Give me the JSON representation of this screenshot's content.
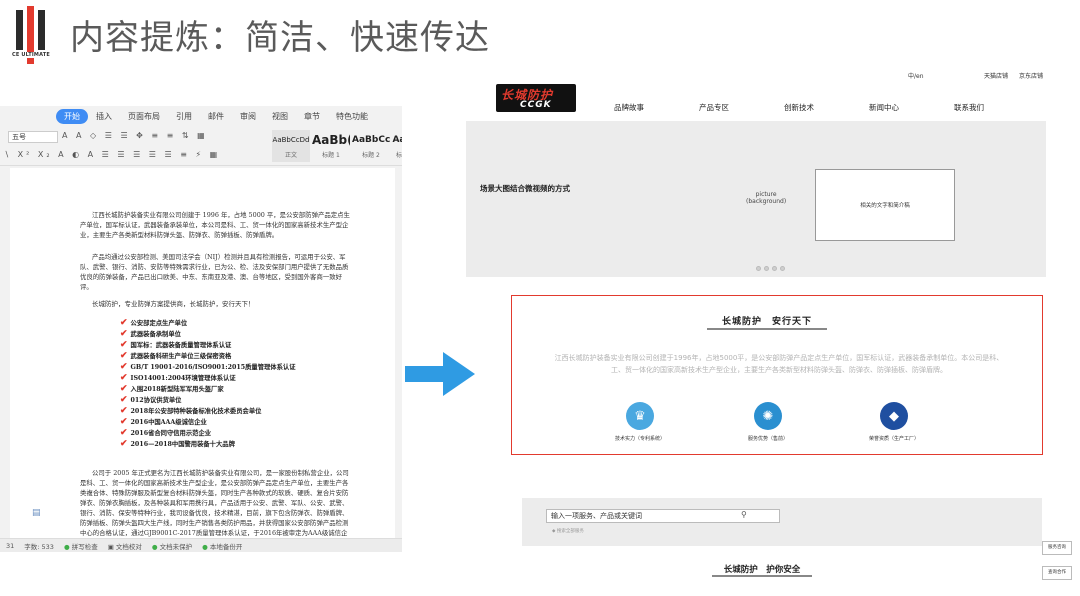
{
  "header": {
    "logo_text": "CE ULTIMATE",
    "title": "内容提炼：简洁、快速传达"
  },
  "word": {
    "tabs": [
      "开始",
      "插入",
      "页面布局",
      "引用",
      "邮件",
      "审阅",
      "视图",
      "章节",
      "特色功能"
    ],
    "font_size": "五号",
    "styles": [
      {
        "sample": "AaBbCcDd",
        "caption": "正文"
      },
      {
        "sample": "AaBb(",
        "caption": "标题 1"
      },
      {
        "sample": "AaBbCc",
        "caption": "标题 2"
      },
      {
        "sample": "Aa",
        "caption": "标"
      }
    ],
    "para1": "江西长城防护装备实业有限公司创建于 1996 年，占地 5000 平，是公安部防弹产品定点生产单位，国军标认证，武器装备承装单位，本公司是科、工、贸一体化的国家高新技术生产型企业，主要生产各类新型材料防弹头盔、防弹衣、防弹插板、防弹盾牌。",
    "para2": "产品均通过公安部检测、美国司法学会（NIJ）检测并且具有检测报告，可运用于公安、军队、武警、银行、消防、安防等特殊需求行业，已为公、检、法及安保部门用户提供了无数品质优良的防弹装备，产品已出口欧美、中东、东南亚及港、澳、台等地区，受到国外客商一致好评。",
    "slogan": "长城防护，专业防弹方案提供商，长城防护，安行天下！",
    "certs": [
      "公安部定点生产单位",
      "武器装备承制单位",
      "国军标：武器装备质量管理体系认证",
      "武器装备科研生产单位三级保密资格",
      "GB/T 19001-2016/ISO9001:2015质量管理体系认证",
      "ISO14001:2004环境管理体系认证",
      "入围2018新型陆军军用头盔厂家",
      "012协议供货单位",
      "2018年公安部特种装备标准化技术委员会单位",
      "2016中国AAA级诚信企业",
      "2016省合同守信用示范企业",
      "2016—2018中国警用装备十大品牌"
    ],
    "para3": "公司于 2005 年正式更名为江西长城防护装备实业有限公司，是一家股份制私营企业，公司是科、工、贸一体化的国家高新技术生产型企业，是公安部防弹产品定点生产单位，主要生产各类複合体、特殊防弹服及新型复合材料防弹头盔，同时生产各种款式的软质、硬质、复合片安防弹衣、防弹衣胸插板，及各种装具和军用携行具，产品适用于公安、武警、军队、公安、武警、银行、消防、保安等特种行业，我司设备优良，技术精湛，目前，旗下包含防弹衣、防弹盾牌、防弹插板、防弹头盔四大生产线，同时生产销售各类防护用品，并获得国家公安部防弹产品检测中心的合格认证，通过GJB9001C-2017质量管理体系认证，于2016年被审定为AAA级诚信企业单位。",
    "status": {
      "page": "31",
      "word_count": "字数: 533",
      "spell": "拼写检查",
      "check": "文档校对",
      "unprotected": "文档未保护",
      "backup": "本地备份开"
    }
  },
  "site": {
    "brand_cn": "长城防护",
    "brand_en": "CCGK",
    "lang": "中/en",
    "stores": [
      "天猫店铺",
      "京东店铺"
    ],
    "nav": [
      "品牌故事",
      "产品专区",
      "创新技术",
      "新闻中心",
      "联系我们"
    ],
    "hero_text": "场景大图结合微视频的方式",
    "picture_label": [
      "picture",
      "(background)"
    ],
    "hero_box": "相关的文字和简介稿",
    "about_title": "长城防护　安行天下",
    "about_text": "江西长城防护装备实业有限公司创建于1996年，占地5000平，是公安部防弹产品定点生产单位，国军标认证，武器装备承制单位。本公司是科、工、贸一体化的国家高新技术生产型企业，主要生产各类新型材料防弹头盔、防弹衣、防弹插板、防弹盾牌。",
    "features": [
      {
        "caption": "技术实力（专利系统）",
        "icon": "certificate-icon",
        "color": "#4aa8e0"
      },
      {
        "caption": "服务优势（售前）",
        "icon": "lightbulb-icon",
        "color": "#2a8fd0"
      },
      {
        "caption": "荣誉资质（生产工厂）",
        "icon": "diamond-icon",
        "color": "#1f4fa0"
      }
    ],
    "search_placeholder": "输入一项服务、产品或关键词",
    "search_hint": "◆ 搜索全部服务",
    "bottom_title": "长城防护　护你安全",
    "side_buttons": [
      "服务咨询",
      "查询合作"
    ]
  },
  "colors": {
    "accent_red": "#e23a2e",
    "arrow_blue": "#2f9be3",
    "word_tab_blue": "#3f8cf4"
  }
}
